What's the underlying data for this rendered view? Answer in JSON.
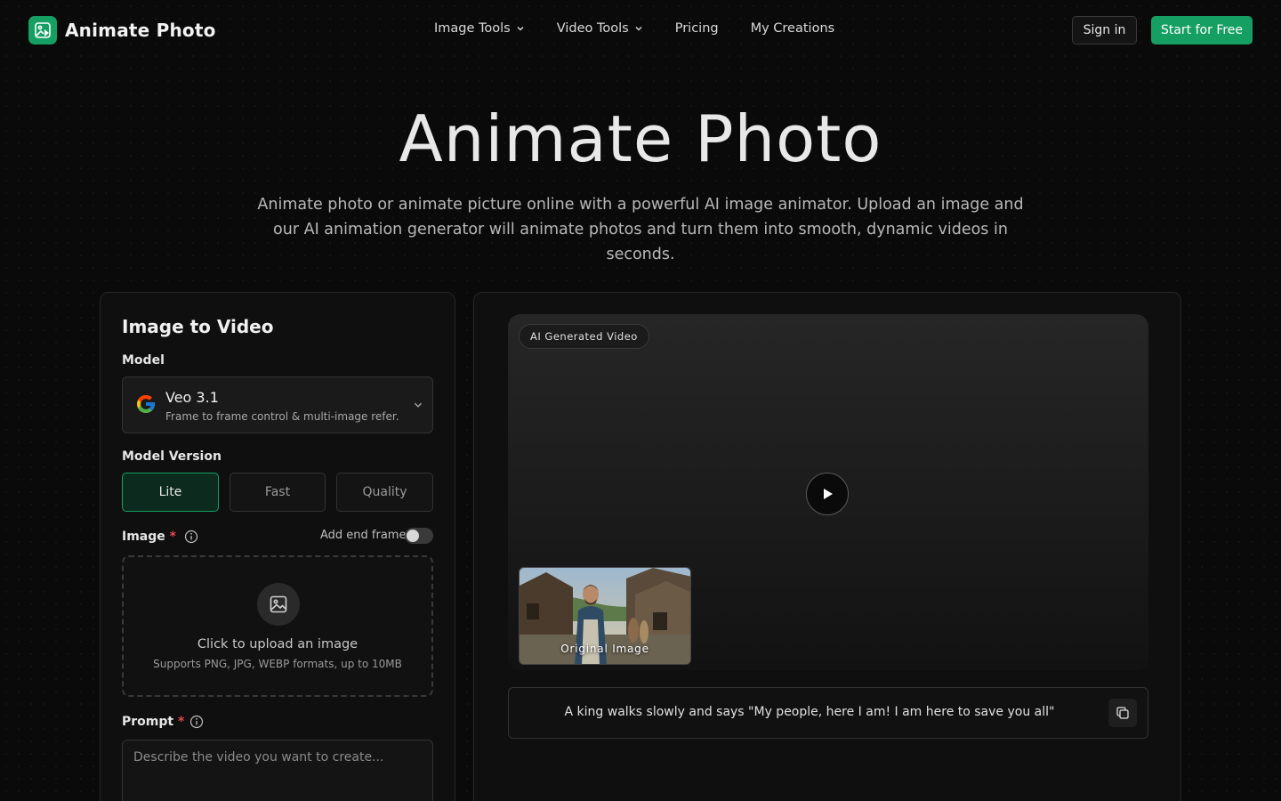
{
  "header": {
    "brand": "Animate Photo",
    "nav": [
      {
        "label": "Image Tools",
        "dropdown": true
      },
      {
        "label": "Video Tools",
        "dropdown": true
      },
      {
        "label": "Pricing",
        "dropdown": false
      },
      {
        "label": "My Creations",
        "dropdown": false
      }
    ],
    "sign_in": "Sign in",
    "start": "Start for Free"
  },
  "hero": {
    "title": "Animate Photo",
    "subtitle": "Animate photo or animate picture online with a powerful AI image animator. Upload an image and our AI animation generator will animate photos and turn them into smooth, dynamic videos in seconds."
  },
  "form": {
    "title": "Image to Video",
    "model_label": "Model",
    "model": {
      "name": "Veo 3.1",
      "description": "Frame to frame control & multi-image refer...",
      "icon": "google-logo-icon"
    },
    "version_label": "Model Version",
    "versions": [
      "Lite",
      "Fast",
      "Quality"
    ],
    "selected_version": "Lite",
    "image_label": "Image",
    "required_mark": "*",
    "end_frame_label": "Add end frame",
    "end_frame_enabled": false,
    "upload": {
      "title": "Click to upload an image",
      "subtitle": "Supports PNG, JPG, WEBP formats, up to 10MB"
    },
    "prompt_label": "Prompt",
    "prompt_placeholder": "Describe the video you want to create..."
  },
  "preview": {
    "badge": "AI Generated Video",
    "thumbnail_label": "Original Image",
    "prompt": "A king walks slowly and says \"My people, here I am! I am here to save you all\""
  },
  "colors": {
    "accent": "#169f62",
    "background": "#0a0a0a",
    "required": "#e5484d"
  }
}
